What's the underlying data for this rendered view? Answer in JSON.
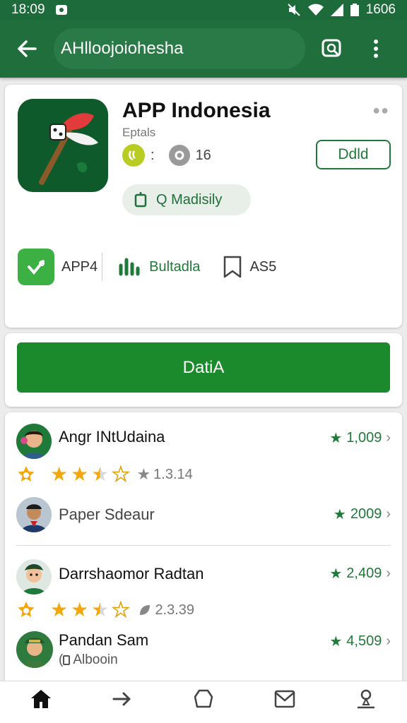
{
  "status": {
    "time": "18:09",
    "battery": "1606"
  },
  "header": {
    "title": "AHlloojoiohesha"
  },
  "app": {
    "name": "APP Indonesia",
    "developer": "Eptals",
    "rating_count": "16",
    "install_label": "Ddld",
    "chip_label": "Q Madisily",
    "info": [
      {
        "icon": "check-icon",
        "label": "APP4"
      },
      {
        "icon": "chart-icon",
        "label": "Bultadla"
      },
      {
        "icon": "bookmark-icon",
        "label": "AS5"
      }
    ]
  },
  "primary_button": {
    "label": "DatiA"
  },
  "reviews": [
    {
      "name": "Angr INtUdaina",
      "score": "1,009",
      "stars": 3.5,
      "rating": "1.3.14"
    },
    {
      "name": "Paper Sdeaur",
      "score": "2009"
    },
    {
      "name": "Darrshaomor Radtan",
      "score": "2,409",
      "stars": 3.5,
      "rating": "2.3.39"
    },
    {
      "name": "Pandan Sam",
      "score": "4,509",
      "subtitle": "Albooin"
    }
  ],
  "bottom_nav": [
    "home-icon",
    "forward-icon",
    "shape-icon",
    "mail-icon",
    "profile-icon"
  ],
  "colors": {
    "primary": "#1f6e3c",
    "accent": "#1a8a2c",
    "star": "#f2a70d"
  }
}
